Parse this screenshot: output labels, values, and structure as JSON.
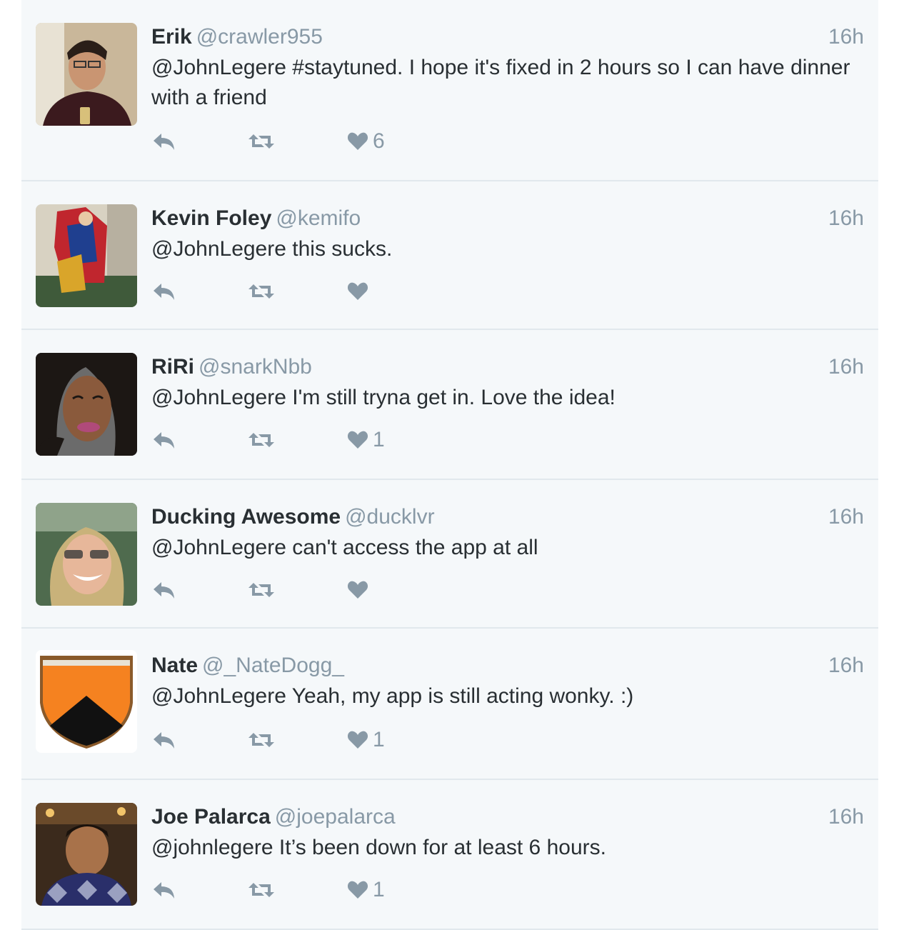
{
  "timeline": {
    "tweets": [
      {
        "name": "Erik",
        "handle": "@crawler955",
        "time": "16h",
        "text": "@JohnLegere #staytuned. I hope it's fixed in 2 hours so I can have dinner with a friend",
        "likes": "6",
        "avatar_icon": "avatar-erik"
      },
      {
        "name": "Kevin Foley",
        "handle": "@kemifo",
        "time": "16h",
        "text": "@JohnLegere this sucks.",
        "likes": "",
        "avatar_icon": "avatar-kevin"
      },
      {
        "name": "RiRi",
        "handle": "@snarkNbb",
        "time": "16h",
        "text": "@JohnLegere I'm still tryna get in. Love the idea!",
        "likes": "1",
        "avatar_icon": "avatar-riri"
      },
      {
        "name": "Ducking Awesome",
        "handle": "@ducklvr",
        "time": "16h",
        "text": "@JohnLegere can't access the app at all",
        "likes": "",
        "avatar_icon": "avatar-ducking"
      },
      {
        "name": "Nate",
        "handle": "@_NateDogg_",
        "time": "16h",
        "text": "@JohnLegere Yeah,  my app is still acting wonky.  :)",
        "likes": "1",
        "avatar_icon": "avatar-nate-shield"
      },
      {
        "name": "Joe Palarca",
        "handle": "@joepalarca",
        "time": "16h",
        "text": "@johnlegere It’s been down for at least 6 hours.",
        "likes": "1",
        "avatar_icon": "avatar-joe"
      }
    ]
  },
  "colors": {
    "background": "#f5f8fa",
    "divider": "#e1e8ed",
    "text": "#292f33",
    "muted": "#8899a6",
    "nate_shield_orange": "#f58220"
  },
  "icons": {
    "reply": "reply-icon",
    "retweet": "retweet-icon",
    "like": "heart-icon"
  }
}
